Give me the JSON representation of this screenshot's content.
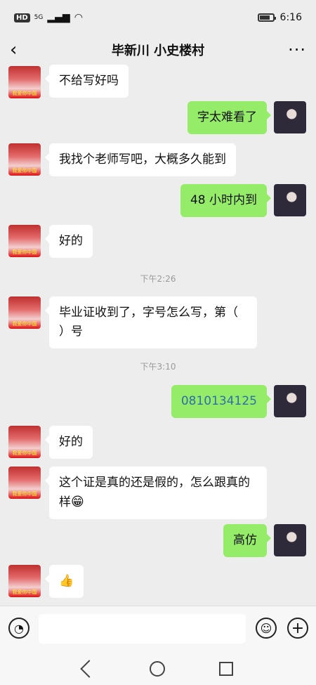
{
  "status": {
    "hd": "HD",
    "net": "5G",
    "time": "6:16"
  },
  "header": {
    "title": "毕新川 小史楼村",
    "back": "‹",
    "more": "···"
  },
  "messages": [
    {
      "side": "left",
      "text": "不给写好吗"
    },
    {
      "side": "right",
      "text": "字太难看了"
    },
    {
      "side": "left",
      "text": "我找个老师写吧，大概多久能到"
    },
    {
      "side": "right",
      "text": "48 小时内到"
    },
    {
      "side": "left",
      "text": "好的"
    },
    {
      "side": "left",
      "text": "毕业证收到了，字号怎么写，第（ ）号"
    },
    {
      "side": "right",
      "text": "0810134125"
    },
    {
      "side": "left",
      "text": "好的"
    },
    {
      "side": "left",
      "text": "这个证是真的还是假的，怎么跟真的样"
    },
    {
      "side": "right",
      "text": "高仿"
    },
    {
      "side": "left",
      "text": "👍"
    }
  ],
  "timestamps": {
    "t1": "下午2:26",
    "t2": "下午3:10"
  },
  "input": {
    "placeholder": ""
  }
}
